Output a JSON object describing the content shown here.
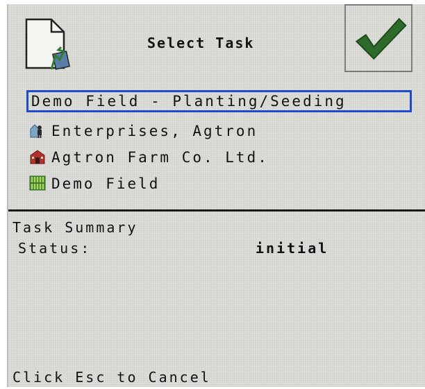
{
  "header": {
    "title": "Select Task",
    "icon": "document-icon",
    "confirm_icon": "checkmark-icon",
    "confirm_color": "#2e6b2a"
  },
  "task": {
    "selected": "Demo Field - Planting/Seeding",
    "highlight_color": "#1c4bd1"
  },
  "hierarchy": [
    {
      "icon": "customer-icon",
      "label": "Enterprises, Agtron"
    },
    {
      "icon": "farm-icon",
      "label": "Agtron Farm Co. Ltd."
    },
    {
      "icon": "field-icon",
      "label": "Demo Field"
    }
  ],
  "summary": {
    "title": "Task Summary",
    "status_label": "Status:",
    "status_value": "initial"
  },
  "footer": {
    "hint": "Click Esc to Cancel"
  }
}
